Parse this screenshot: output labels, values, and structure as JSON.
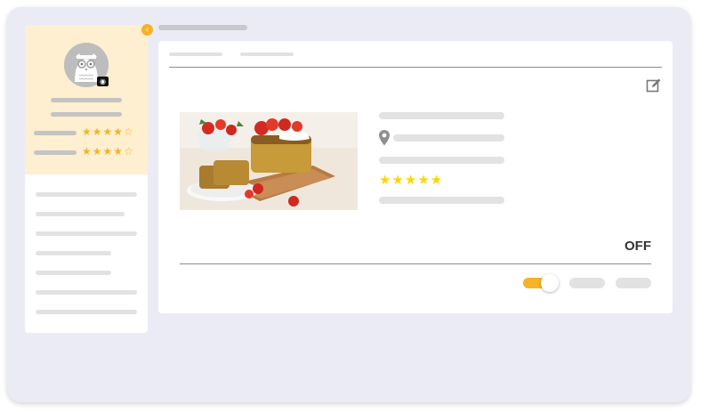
{
  "profile": {
    "rating_stars": [
      "★★★★☆",
      "★★★★☆"
    ]
  },
  "listing": {
    "rating_stars": "★★★★★",
    "status_label": "OFF",
    "toggle_on_fraction": 1
  },
  "colors": {
    "accent": "#f5b325",
    "profile_bg": "#fdefcf",
    "frame_bg": "#ebebf5",
    "star_yellow": "#ffd500"
  },
  "icons": [
    "chevron-left-icon",
    "camera-icon",
    "edit-icon",
    "location-pin-icon",
    "star-icon"
  ]
}
